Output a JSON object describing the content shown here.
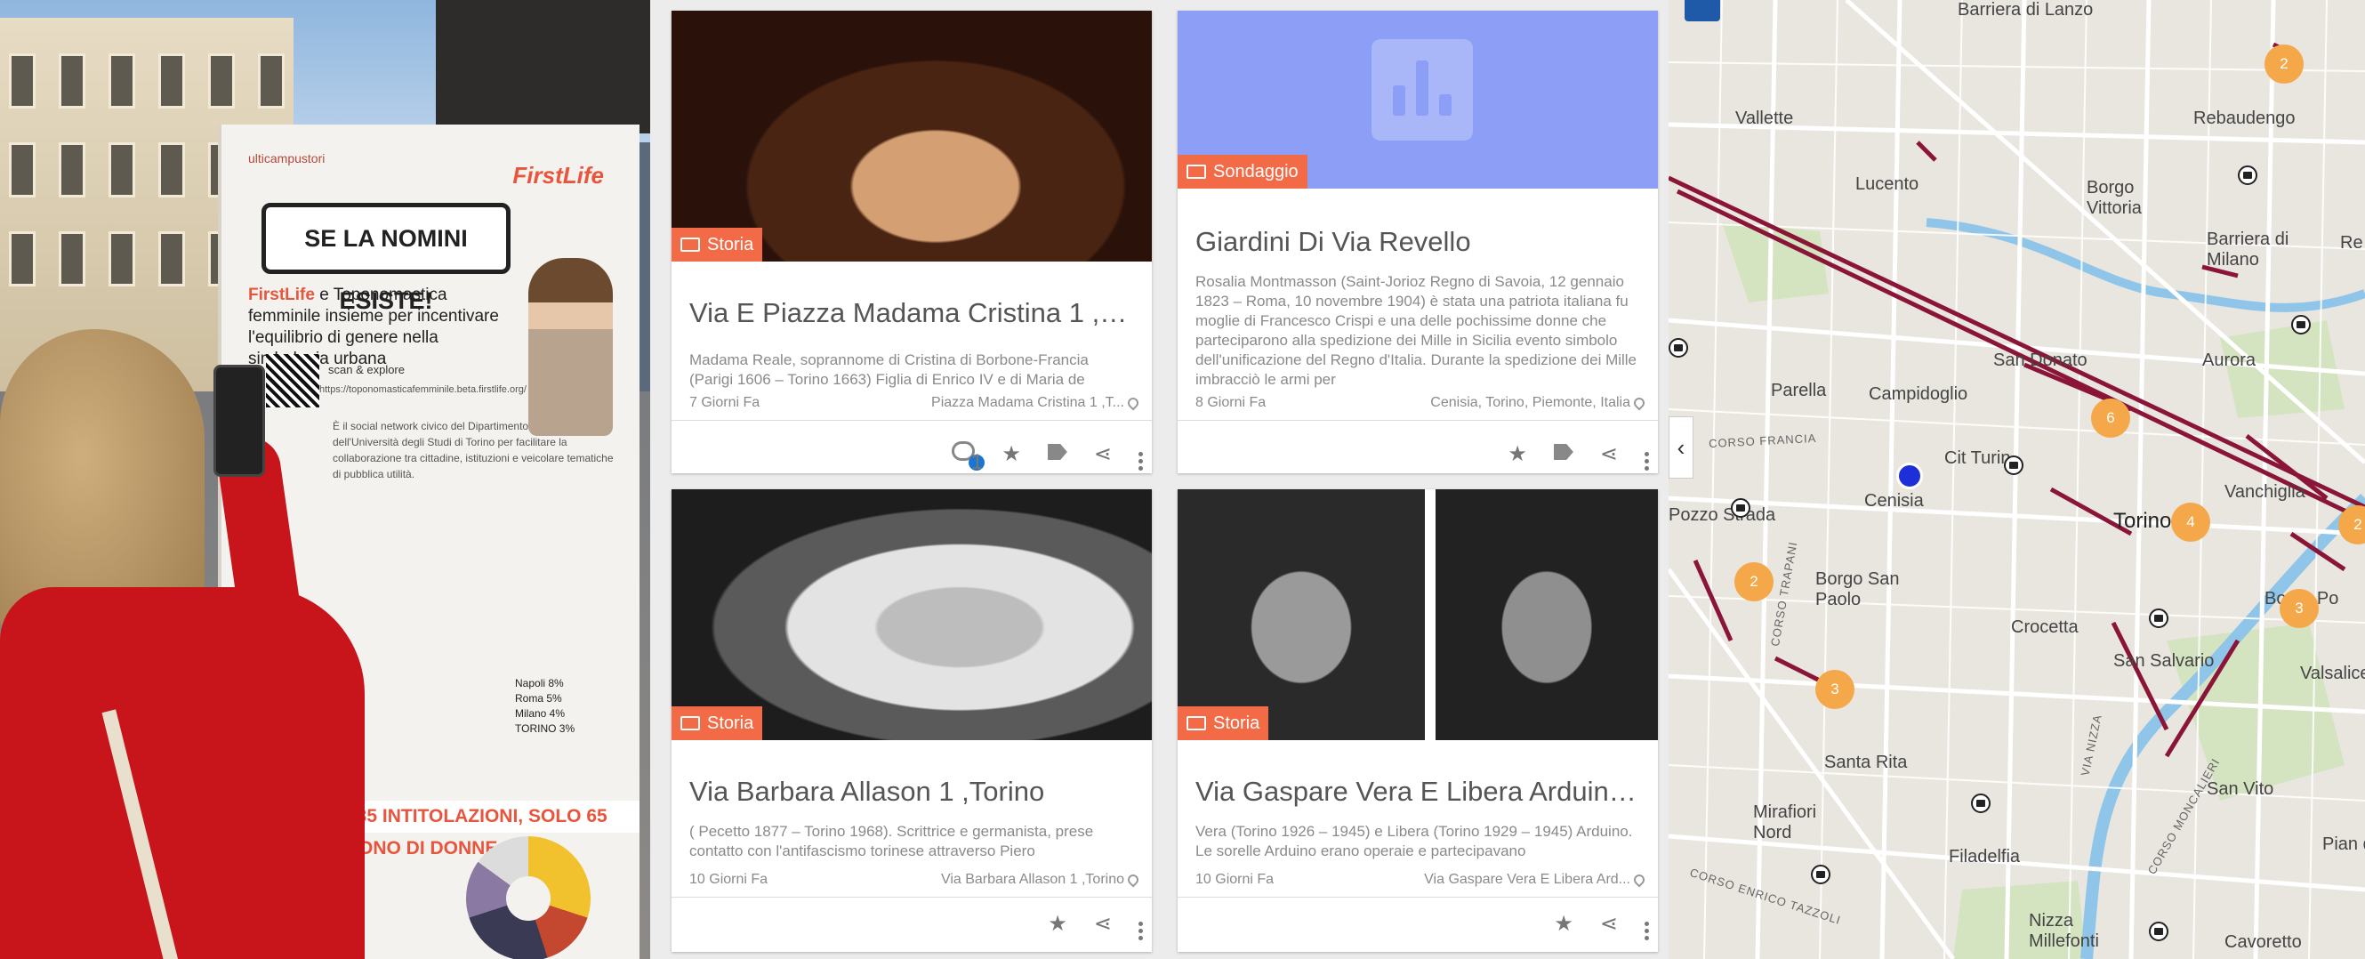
{
  "photo": {
    "banner": {
      "logo_left": "ulticampustori",
      "logo_right": "FirstLife",
      "headline": "SE LA NOMINI ESISTE!",
      "subtitle_brand": "FirstLife",
      "subtitle": " e Toponomastica femminile insieme per incentivare l'equilibrio di genere nella simbologia urbana",
      "scan": "scan & explore",
      "url": "https://toponomasticafemminile.beta.firstlife.org/",
      "body": "È il social network civico del Dipartimento di Informatica dell'Università degli Studi di Torino per facilitare la collaborazione tra cittadine, istituzioni e veicolare tematiche di pubblica utilità.",
      "footline": "135 INTITOLAZIONI, SOLO 65 SONO DI DONNE",
      "stats": [
        "Napoli 8%",
        "Roma 5%",
        "Milano 4%",
        "TORINO 3%"
      ]
    }
  },
  "cards": [
    {
      "category": "Storia",
      "title": "Via E Piazza Madama Cristina 1 ,T...",
      "description": "Madama Reale, soprannome di Cristina di Borbone-Francia (Parigi 1606 – Torino 1663) Figlia di Enrico IV e di Maria de",
      "time": "7 Giorni Fa",
      "location": "Piazza Madama Cristina 1 ,T...",
      "comments": "1"
    },
    {
      "category": "Sondaggio",
      "title": "Giardini Di Via Revello",
      "description": "Rosalia Montmasson (Saint-Jorioz Regno di Savoia, 12 gennaio 1823 – Roma, 10 novembre 1904) è stata una patriota italiana fu moglie di Francesco Crispi e una delle pochissime donne che parteciparono alla spedizione dei Mille in Sicilia evento simbolo dell'unificazione del Regno d'Italia. Durante la spedizione dei Mille imbracciò le armi per",
      "time": "8 Giorni Fa",
      "location": "Cenisia, Torino, Piemonte, Italia"
    },
    {
      "category": "Storia",
      "title": "Via Barbara Allason 1 ,Torino",
      "description": "( Pecetto 1877 –  Torino 1968). Scrittrice e germanista, prese contatto con l'antifascismo torinese attraverso Piero",
      "time": "10 Giorni Fa",
      "location": "Via Barbara Allason 1 ,Torino"
    },
    {
      "category": "Storia",
      "title": "Via Gaspare Vera E Libera Arduino ...",
      "description": "Vera (Torino 1926 – 1945) e Libera (Torino 1929 – 1945) Arduino. Le sorelle Arduino erano operaie e partecipavano",
      "time": "10 Giorni Fa",
      "location": "Via Gaspare Vera E Libera Ard..."
    }
  ],
  "map": {
    "labels": [
      "Barriera di Lanzo",
      "Rebaudengo",
      "Vallette",
      "Lucento",
      "Borgo Vittoria",
      "Barriera di Milano",
      "Re",
      "Aurora",
      "San Donato",
      "Parella",
      "Campidoglio",
      "Cit Turin",
      "Cenisia",
      "Torino",
      "Vanchiglia",
      "Pozzo Strada",
      "Borgo San Paolo",
      "Crocetta",
      "San Salvario",
      "Borgo Po",
      "Valsalice",
      "Santa Rita",
      "San Vito",
      "Mirafiori Nord",
      "Filadelfia",
      "Pian del",
      "Nizza Millefonti",
      "Cavoretto"
    ],
    "road_labels": [
      "CORSO FRANCIA",
      "CORSO TRAPANI",
      "VIA NIZZA",
      "CORSO MONCALIERI",
      "CORSO ENRICO TAZZOLI"
    ],
    "clusters": [
      "2",
      "6",
      "4",
      "2",
      "3",
      "2",
      "3"
    ],
    "colors": {
      "cluster": "#f5a84a",
      "route": "#8a1538",
      "river": "#8ec5e8",
      "poll_marker": "#1d2fd8"
    }
  }
}
